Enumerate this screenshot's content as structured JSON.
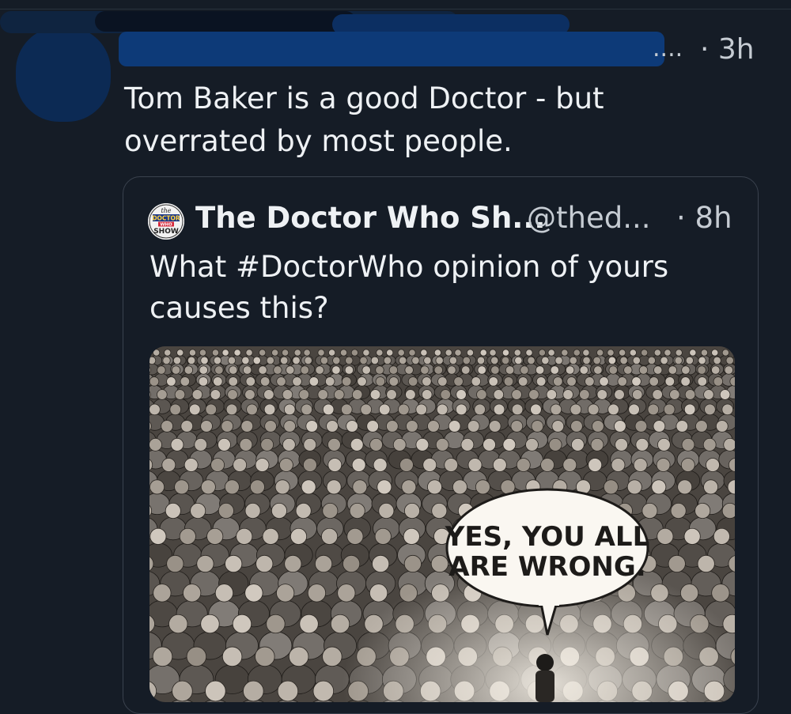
{
  "post": {
    "author_name_tail": "....",
    "time": "· 3h",
    "text": "Tom Baker is a good Doctor - but overrated by most people."
  },
  "quote": {
    "author_name": "The Doctor Who Sh...",
    "handle": "@thed...",
    "time": "· 8h",
    "text": "What #DoctorWho opinion of yours causes this?",
    "avatar_logo_text": "the DOCTOR WHO SHOW",
    "image": {
      "speech_bubble_line1": "YES, YOU ALL",
      "speech_bubble_line2": "ARE WRONG."
    }
  },
  "colors": {
    "background": "#151c26",
    "text": "#eef1f4",
    "muted": "#c6ccd3",
    "card_border": "#3a424e",
    "redaction": "#0d3a78"
  }
}
